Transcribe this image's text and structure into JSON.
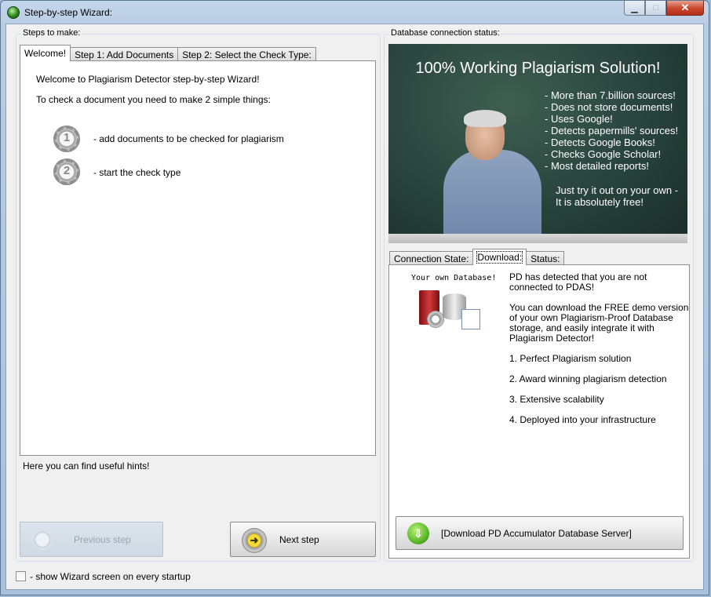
{
  "window": {
    "title": "Step-by-step Wizard:",
    "min_glyph": "▁",
    "max_glyph": "□",
    "close_glyph": "✕"
  },
  "left": {
    "group_title": "Steps to make:",
    "tabs": [
      {
        "label": "Welcome!",
        "active": true
      },
      {
        "label": "Step 1: Add Documents",
        "active": false
      },
      {
        "label": "Step 2: Select the Check Type:",
        "active": false
      }
    ],
    "welcome_text": "Welcome to Plagiarism Detector step-by-step Wizard!",
    "intro_text": "To check a document you need to make 2 simple things:",
    "steps": [
      {
        "number": "1",
        "text": "- add documents to be checked for plagiarism"
      },
      {
        "number": "2",
        "text": "- start the check type"
      }
    ],
    "hint": "Here you can find useful hints!",
    "prev_button": "Previous step",
    "next_button": "Next step"
  },
  "right": {
    "group_title": "Database connection status:",
    "ad": {
      "title": "100% Working Plagiarism Solution!",
      "bullets": [
        "- More than 7.billion sources!",
        "- Does not store documents!",
        "- Uses Google!",
        "- Detects papermills' sources!",
        "- Detects Google Books!",
        "- Checks Google Scholar!",
        "- Most detailed reports!"
      ],
      "cta_line1": "Just try it out on your own -",
      "cta_line2": "It is absolutely free!"
    },
    "tabs": [
      {
        "label": "Connection State:",
        "active": false
      },
      {
        "label": "Download:",
        "active": true
      },
      {
        "label": "Status:",
        "active": false
      }
    ],
    "db_caption": "Your own Database!",
    "paragraphs": [
      "PD has detected that you are not",
      "connected to PDAS!",
      "You can download the FREE demo version",
      "of your own Plagiarism-Proof Database",
      "storage, and easily integrate it with",
      "Plagiarism Detector!",
      "1. Perfect Plagiarism solution",
      "2. Award winning plagiarism detection",
      "3. Extensive scalability",
      "4. Deployed into your infrastructure"
    ],
    "download_button": "[Download PD Accumulator Database Server]"
  },
  "footer": {
    "checkbox_label": "- show Wizard screen on every startup",
    "checked": false
  }
}
